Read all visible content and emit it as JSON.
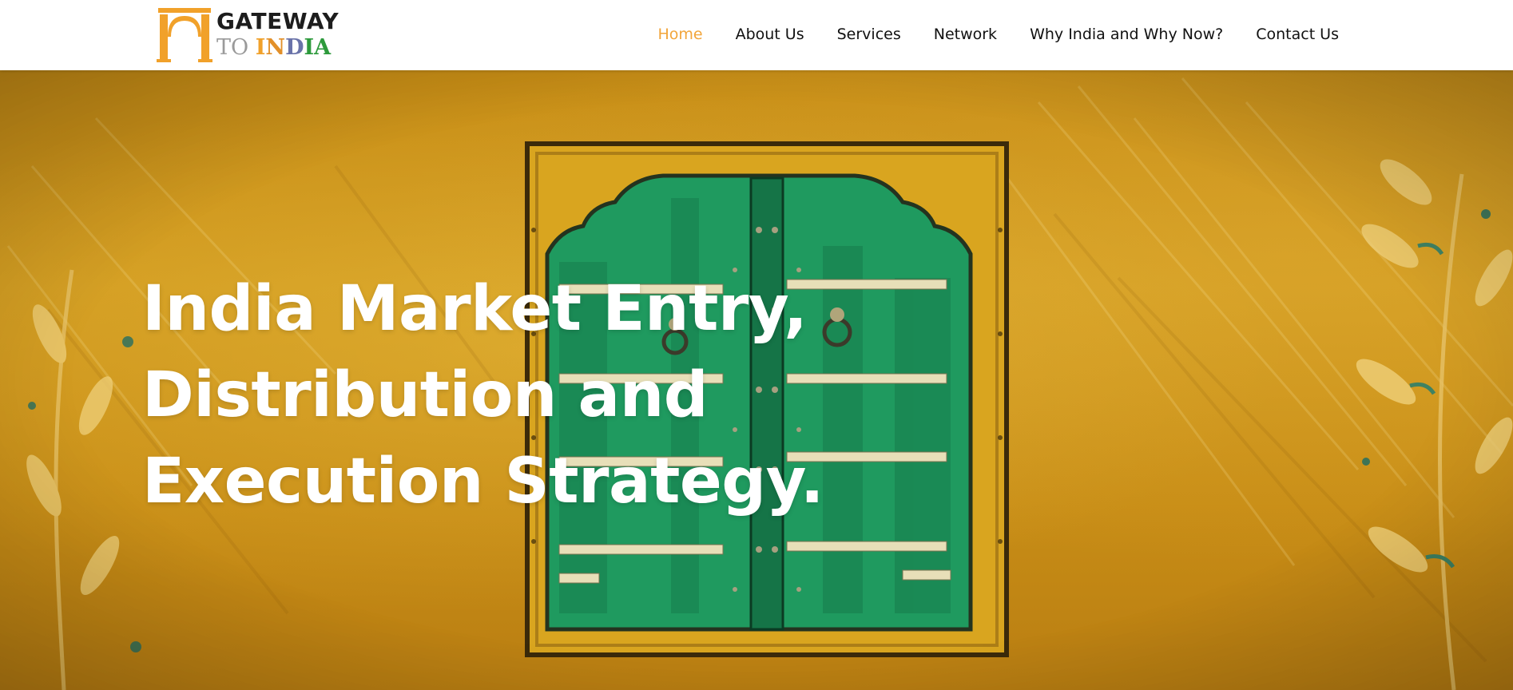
{
  "brand": {
    "line1": "GATEWAY",
    "line2_prefix": "TO ",
    "line2_letters": [
      "I",
      "N",
      "D",
      "I",
      "A"
    ],
    "colors": {
      "saffron": "#f1a12a",
      "green": "#2d9a3c",
      "navy": "#6a73a9",
      "grey": "#9a9a9a"
    }
  },
  "nav": {
    "items": [
      {
        "label": "Home",
        "active": true
      },
      {
        "label": "About Us",
        "active": false
      },
      {
        "label": "Services",
        "active": false
      },
      {
        "label": "Network",
        "active": false
      },
      {
        "label": "Why India and Why Now?",
        "active": false
      },
      {
        "label": "Contact Us",
        "active": false
      }
    ],
    "active_color": "#f2a53a"
  },
  "hero": {
    "title_lines": [
      "India Market Entry,",
      "Distribution and",
      "Execution Strategy."
    ],
    "image": "green-door-on-yellow-wall",
    "colors": {
      "wall": "#cf971d",
      "door": "#1f9a5f",
      "text": "#ffffff"
    }
  }
}
